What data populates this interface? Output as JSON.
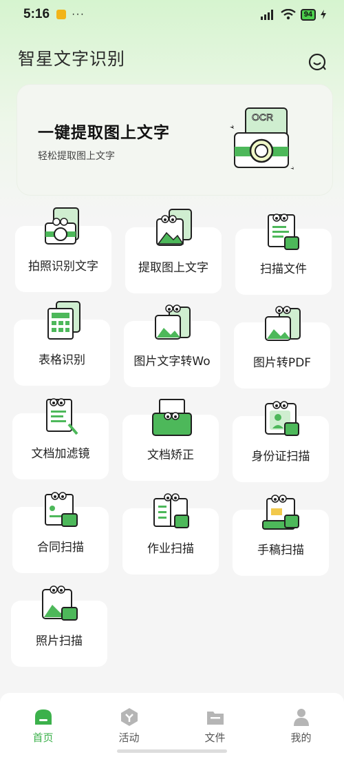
{
  "status_bar": {
    "time": "5:16",
    "dots": "···",
    "battery": "94"
  },
  "header": {
    "title": "智星文字识别"
  },
  "banner": {
    "title": "一键提取图上文字",
    "subtitle": "轻松提取图上文字",
    "art_text": "OCR"
  },
  "features": [
    {
      "label": "拍照识别文字",
      "icon": "camera-doc-icon"
    },
    {
      "label": "提取图上文字",
      "icon": "image-doc-icon"
    },
    {
      "label": "扫描文件",
      "icon": "scan-file-icon"
    },
    {
      "label": "表格识别",
      "icon": "table-icon"
    },
    {
      "label": "图片文字转Wo",
      "icon": "image-to-word-icon"
    },
    {
      "label": "图片转PDF",
      "icon": "image-to-pdf-icon"
    },
    {
      "label": "文档加滤镜",
      "icon": "doc-filter-icon"
    },
    {
      "label": "文档矫正",
      "icon": "doc-correct-icon"
    },
    {
      "label": "身份证扫描",
      "icon": "id-card-icon"
    },
    {
      "label": "合同扫描",
      "icon": "contract-icon"
    },
    {
      "label": "作业扫描",
      "icon": "homework-icon"
    },
    {
      "label": "手稿扫描",
      "icon": "manuscript-icon"
    },
    {
      "label": "照片扫描",
      "icon": "photo-scan-icon"
    }
  ],
  "bottom_nav": [
    {
      "label": "首页",
      "icon": "home-icon",
      "active": true
    },
    {
      "label": "活动",
      "icon": "activity-icon",
      "active": false
    },
    {
      "label": "文件",
      "icon": "folder-icon",
      "active": false
    },
    {
      "label": "我的",
      "icon": "profile-icon",
      "active": false
    }
  ],
  "colors": {
    "accent": "#3cb14b",
    "icon_green": "#4db85a",
    "banner_bg": "#f3f6f1"
  }
}
